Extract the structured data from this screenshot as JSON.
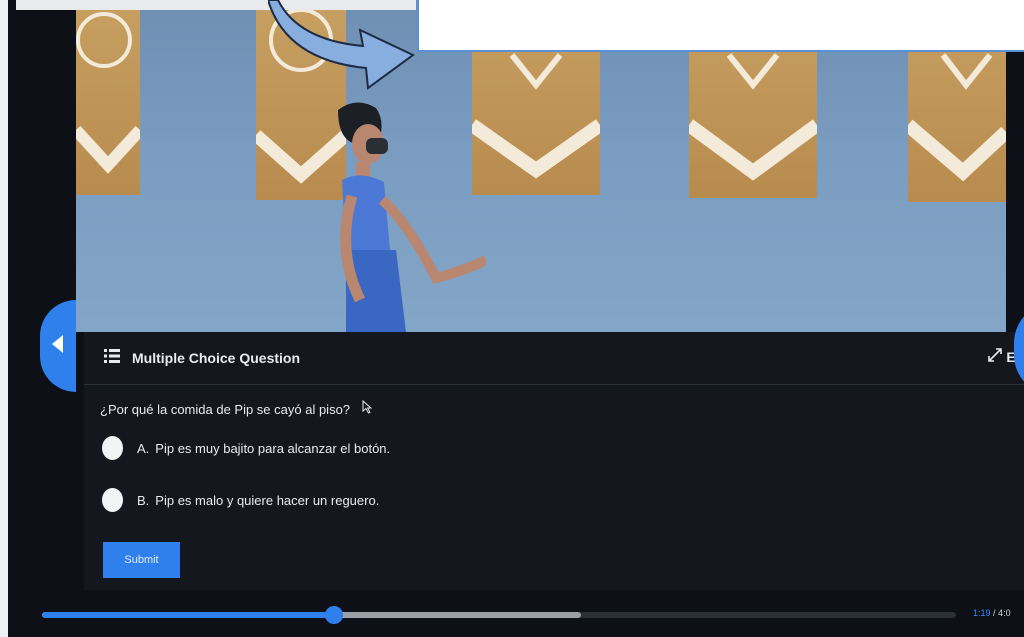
{
  "panel": {
    "title": "Multiple Choice Question",
    "expand_label": "Exp",
    "question": "¿Por qué la comida de Pip se cayó al piso?",
    "options": [
      {
        "letter": "A.",
        "text": "Pip es muy bajito para alcanzar el botón."
      },
      {
        "letter": "B.",
        "text": "Pip es malo y quiere hacer un reguero."
      }
    ],
    "submit_label": "Submit"
  },
  "player": {
    "current_time": "1:19",
    "separator": "/",
    "duration": "4:0",
    "progress": 0.32,
    "buffered": 0.59
  },
  "icons": {
    "list": "list-icon",
    "expand": "expand-icon",
    "prev": "chevron-left-icon",
    "next": "chevron-right-icon",
    "cursor": "mouse-cursor-icon",
    "annotation_arrow": "curved-arrow-icon"
  },
  "colors": {
    "accent": "#2f80ed",
    "panel_bg": "#14181e",
    "banner_gold": "#c7a062",
    "wall_blue": "#7a9cc0"
  }
}
